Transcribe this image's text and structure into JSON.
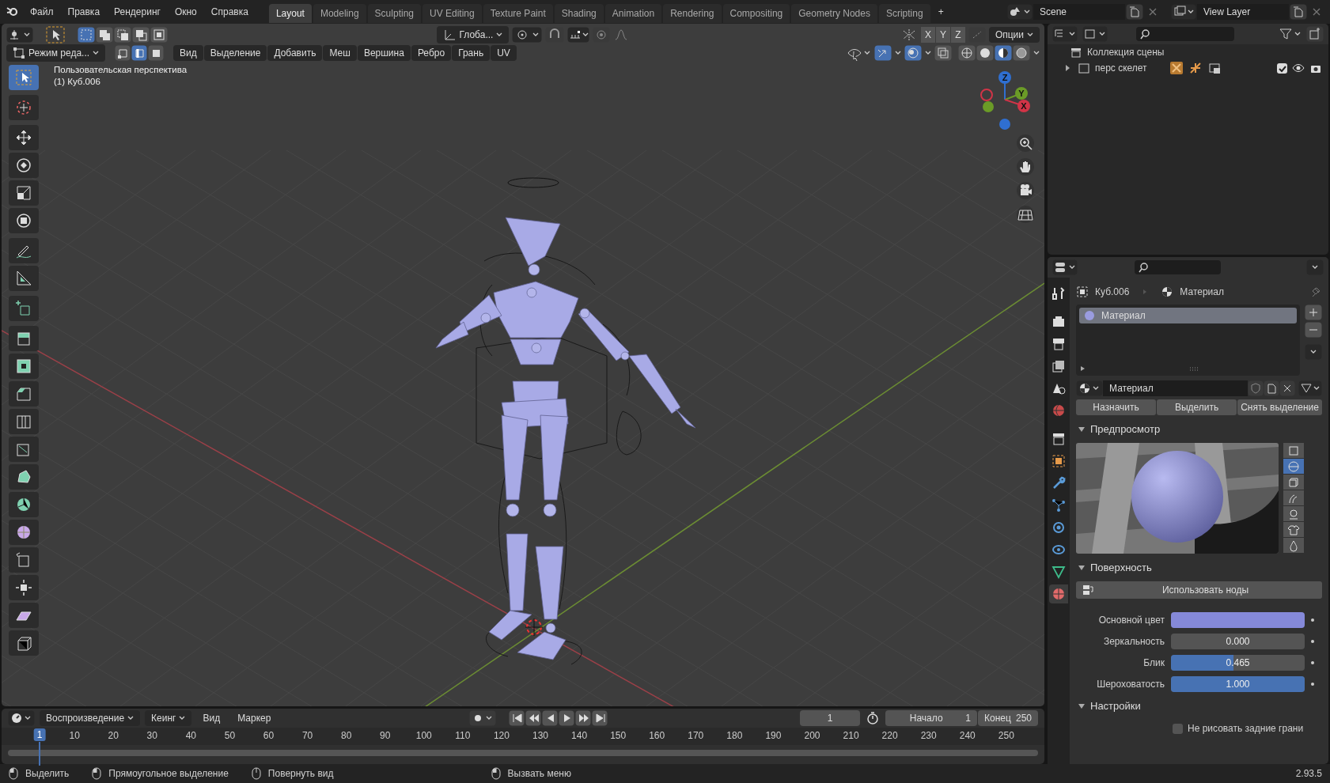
{
  "topbar": {
    "menus": [
      "Файл",
      "Правка",
      "Рендеринг",
      "Окно",
      "Справка"
    ],
    "workspaces": [
      {
        "label": "Layout",
        "selected": true
      },
      {
        "label": "Modeling",
        "selected": false
      },
      {
        "label": "Sculpting",
        "selected": false
      },
      {
        "label": "UV Editing",
        "selected": false
      },
      {
        "label": "Texture Paint",
        "selected": false
      },
      {
        "label": "Shading",
        "selected": false
      },
      {
        "label": "Animation",
        "selected": false
      },
      {
        "label": "Rendering",
        "selected": false
      },
      {
        "label": "Compositing",
        "selected": false
      },
      {
        "label": "Geometry Nodes",
        "selected": false
      },
      {
        "label": "Scripting",
        "selected": false
      }
    ],
    "add_workspace": "+",
    "scene": "Scene",
    "view_layer": "View Layer"
  },
  "viewport": {
    "header_top": {
      "select_ops": [
        {
          "selected": true
        },
        {
          "selected": false
        },
        {
          "selected": false
        },
        {
          "selected": false
        },
        {
          "selected": false
        }
      ],
      "orientation": "Глоба...",
      "axes": [
        "X",
        "Y",
        "Z"
      ],
      "options": "Опции"
    },
    "header_bottom": {
      "mode": "Режим реда...",
      "select_modes": [
        {
          "selected": false
        },
        {
          "selected": true
        },
        {
          "selected": false
        }
      ],
      "menus": [
        "Вид",
        "Выделение",
        "Добавить",
        "Меш",
        "Вершина",
        "Ребро",
        "Грань",
        "UV"
      ],
      "toggles": [
        {
          "on": true
        },
        {
          "on": true
        },
        {
          "on": false
        }
      ],
      "shading": [
        {
          "selected": false
        },
        {
          "selected": false
        },
        {
          "selected": true
        },
        {
          "selected": false
        }
      ]
    },
    "info": [
      "Пользовательская перспектива",
      "(1) Куб.006"
    ],
    "gizmo_labels": [
      "Z",
      "Y",
      "X"
    ],
    "tools": [
      {
        "selected": true
      },
      {
        "selected": false
      },
      {
        "selected": false
      },
      {
        "selected": false
      },
      {
        "selected": false
      },
      {
        "selected": false
      },
      {
        "selected": false
      },
      {
        "selected": false
      },
      {
        "selected": false
      },
      {
        "selected": false
      },
      {
        "selected": false
      },
      {
        "selected": false
      },
      {
        "selected": false
      },
      {
        "selected": false
      },
      {
        "selected": false
      },
      {
        "selected": false
      },
      {
        "selected": false
      },
      {
        "selected": false
      },
      {
        "selected": false
      },
      {
        "selected": false
      },
      {
        "selected": false
      }
    ]
  },
  "timeline": {
    "playback": "Воспроизведение",
    "keying": "Кеинг",
    "menus": [
      "Вид",
      "Маркер"
    ],
    "current_frame": "1",
    "start_label": "Начало",
    "start": "1",
    "end_label": "Конец",
    "end": "250",
    "ticks": [
      {
        "label": "1",
        "selected": true
      },
      {
        "label": "10",
        "selected": false
      },
      {
        "label": "20",
        "selected": false
      },
      {
        "label": "30",
        "selected": false
      },
      {
        "label": "40",
        "selected": false
      },
      {
        "label": "50",
        "selected": false
      },
      {
        "label": "60",
        "selected": false
      },
      {
        "label": "70",
        "selected": false
      },
      {
        "label": "80",
        "selected": false
      },
      {
        "label": "90",
        "selected": false
      },
      {
        "label": "100",
        "selected": false
      },
      {
        "label": "110",
        "selected": false
      },
      {
        "label": "120",
        "selected": false
      },
      {
        "label": "130",
        "selected": false
      },
      {
        "label": "140",
        "selected": false
      },
      {
        "label": "150",
        "selected": false
      },
      {
        "label": "160",
        "selected": false
      },
      {
        "label": "170",
        "selected": false
      },
      {
        "label": "180",
        "selected": false
      },
      {
        "label": "190",
        "selected": false
      },
      {
        "label": "200",
        "selected": false
      },
      {
        "label": "210",
        "selected": false
      },
      {
        "label": "220",
        "selected": false
      },
      {
        "label": "230",
        "selected": false
      },
      {
        "label": "240",
        "selected": false
      },
      {
        "label": "250",
        "selected": false
      }
    ]
  },
  "outliner": {
    "items": [
      {
        "label": "Коллекция сцены",
        "children": [
          {
            "label": "перс скелет",
            "expanded": false,
            "checked": true
          }
        ]
      }
    ]
  },
  "properties": {
    "tabs": [
      {
        "selected": false
      },
      {
        "selected": false
      },
      {
        "selected": false
      },
      {
        "selected": false
      },
      {
        "selected": false
      },
      {
        "selected": false
      },
      {
        "selected": false
      },
      {
        "selected": false
      },
      {
        "selected": false
      },
      {
        "selected": false
      },
      {
        "selected": false
      },
      {
        "selected": false
      },
      {
        "selected": false
      },
      {
        "selected": true
      }
    ],
    "breadcrumb": [
      "Куб.006",
      "Материал"
    ],
    "slots": [
      {
        "label": "Материал",
        "selected": true
      }
    ],
    "material": "Материал",
    "buttons": [
      "Назначить",
      "Выделить",
      "Снять выделение"
    ],
    "preview": {
      "title": "Предпросмотр",
      "expanded": true,
      "types": [
        {
          "selected": false
        },
        {
          "selected": true
        },
        {
          "selected": false
        },
        {
          "selected": false
        },
        {
          "selected": false
        },
        {
          "selected": false
        },
        {
          "selected": false
        }
      ]
    },
    "surface": {
      "title": "Поверхность",
      "expanded": true,
      "use_nodes": "Использовать ноды",
      "fields": [
        {
          "kind": "color",
          "label": "Основной цвет",
          "color": "#8589d9"
        },
        {
          "kind": "slider",
          "label": "Зеркальность",
          "value": "0.000",
          "level": 0
        },
        {
          "kind": "slider",
          "label": "Блик",
          "value": "0.465",
          "level": 0.465
        },
        {
          "kind": "slider",
          "label": "Шероховатость",
          "value": "1.000",
          "level": 1
        }
      ]
    },
    "settings": {
      "title": "Настройки",
      "expanded": true,
      "checkbox": {
        "label": "Не рисовать задние грани",
        "checked": false
      }
    }
  },
  "status": {
    "items": [
      "Выделить",
      "Прямоугольное выделение",
      "Повернуть вид",
      "Вызвать меню"
    ],
    "version": "2.93.5"
  }
}
